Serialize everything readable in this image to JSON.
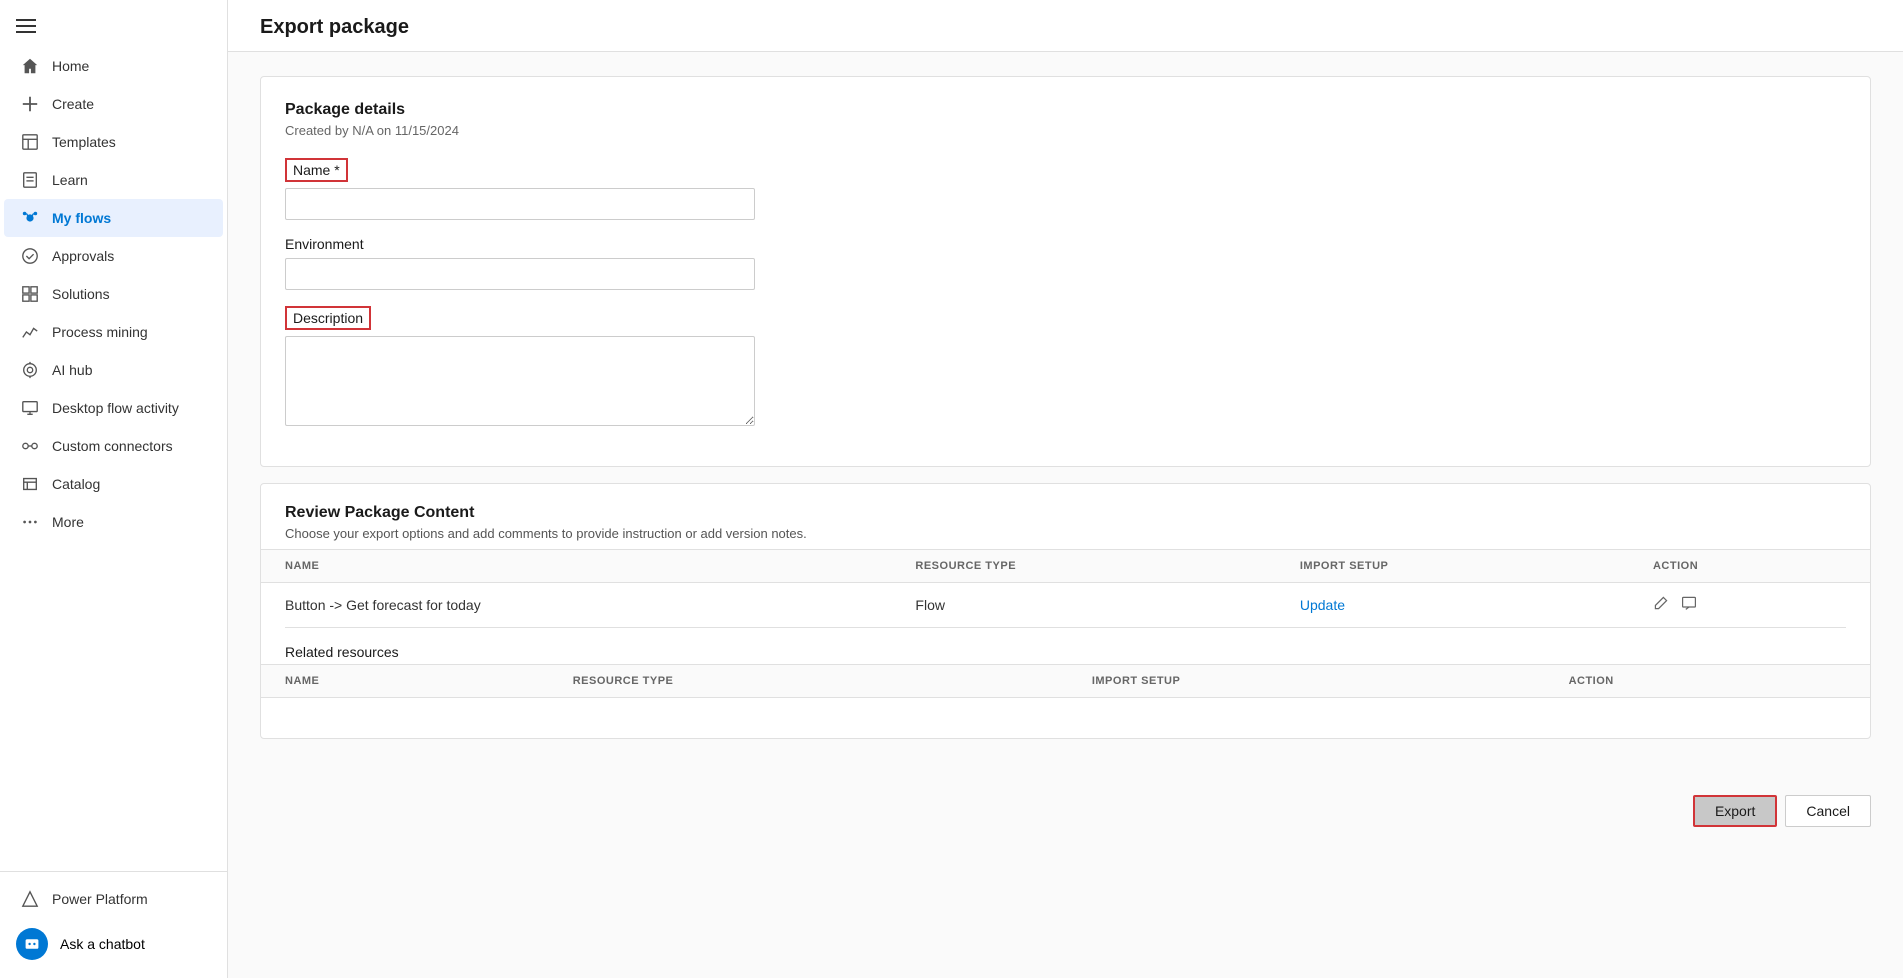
{
  "sidebar": {
    "hamburger_label": "Menu",
    "items": [
      {
        "id": "home",
        "label": "Home",
        "icon": "🏠"
      },
      {
        "id": "create",
        "label": "Create",
        "icon": "+"
      },
      {
        "id": "templates",
        "label": "Templates",
        "icon": "📄"
      },
      {
        "id": "learn",
        "label": "Learn",
        "icon": "📖"
      },
      {
        "id": "my-flows",
        "label": "My flows",
        "icon": "💧",
        "active": true
      },
      {
        "id": "approvals",
        "label": "Approvals",
        "icon": "✅"
      },
      {
        "id": "solutions",
        "label": "Solutions",
        "icon": "🧩"
      },
      {
        "id": "process-mining",
        "label": "Process mining",
        "icon": "📊"
      },
      {
        "id": "ai-hub",
        "label": "AI hub",
        "icon": "🤖"
      },
      {
        "id": "desktop-flow-activity",
        "label": "Desktop flow activity",
        "icon": "🖥"
      },
      {
        "id": "custom-connectors",
        "label": "Custom connectors",
        "icon": "🔌"
      },
      {
        "id": "catalog",
        "label": "Catalog",
        "icon": "📚"
      },
      {
        "id": "more",
        "label": "More",
        "icon": "···"
      }
    ],
    "bottom_item": {
      "label": "Power Platform",
      "icon": "⚡"
    },
    "chatbot_label": "Ask a chatbot"
  },
  "page": {
    "title": "Export package"
  },
  "package_details": {
    "card_title": "Package details",
    "card_subtitle": "Created by N/A on 11/15/2024",
    "name_label": "Name *",
    "name_placeholder": "",
    "environment_label": "Environment",
    "environment_placeholder": "",
    "description_label": "Description",
    "description_placeholder": ""
  },
  "review_package": {
    "section_title": "Review Package Content",
    "section_subtitle": "Choose your export options and add comments to provide instruction or add version notes.",
    "table_headers": {
      "name": "NAME",
      "resource_type": "RESOURCE TYPE",
      "import_setup": "IMPORT SETUP",
      "action": "ACTION"
    },
    "rows": [
      {
        "name": "Button -> Get forecast for today",
        "resource_type": "Flow",
        "import_setup": "Update",
        "import_setup_link": true
      }
    ],
    "related_resources_title": "Related resources",
    "related_headers": {
      "name": "NAME",
      "resource_type": "RESOURCE TYPE",
      "import_setup": "IMPORT SETUP",
      "action": "ACTION"
    }
  },
  "footer": {
    "export_label": "Export",
    "cancel_label": "Cancel"
  }
}
